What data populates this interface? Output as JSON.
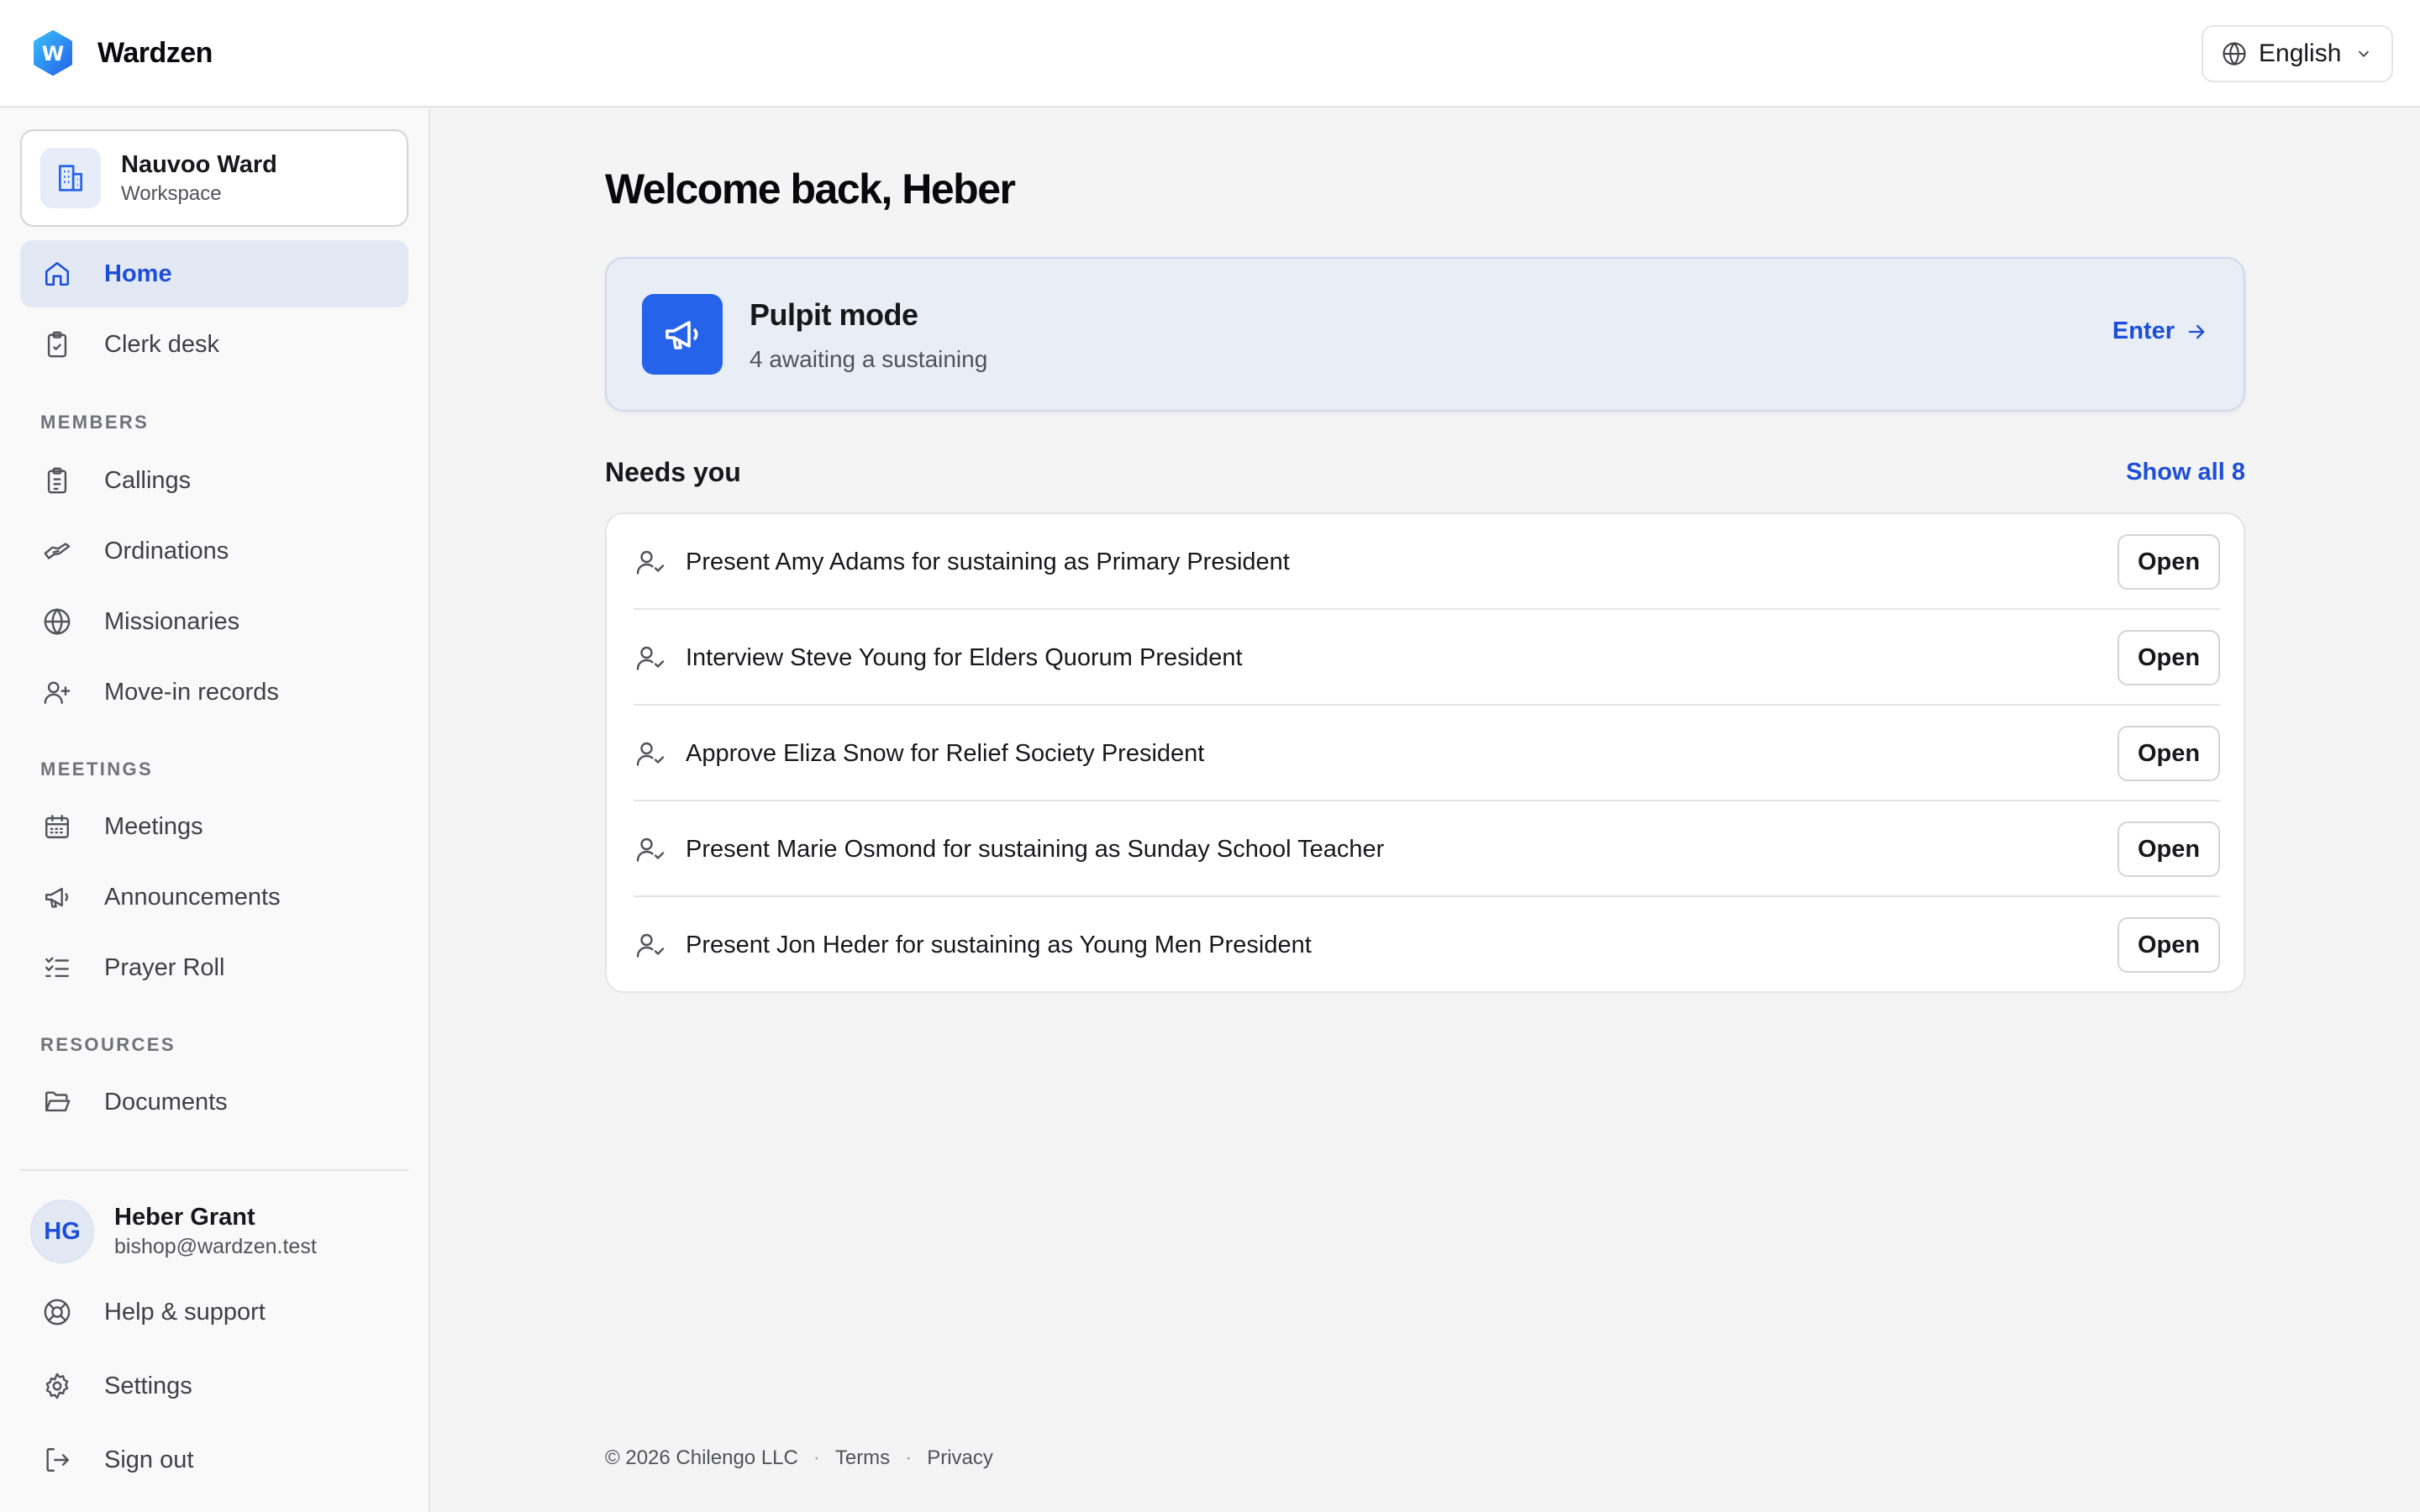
{
  "brand": {
    "name": "Wardzen",
    "logo_letter": "W"
  },
  "language": {
    "label": "English"
  },
  "workspace": {
    "name": "Nauvoo Ward",
    "subtitle": "Workspace"
  },
  "nav": {
    "home": "Home",
    "clerk_desk": "Clerk desk",
    "members_section": "MEMBERS",
    "callings": "Callings",
    "ordinations": "Ordinations",
    "missionaries": "Missionaries",
    "move_in": "Move-in records",
    "meetings_section": "MEETINGS",
    "meetings": "Meetings",
    "announcements": "Announcements",
    "prayer_roll": "Prayer Roll",
    "resources_section": "RESOURCES",
    "documents": "Documents"
  },
  "user": {
    "initials": "HG",
    "name": "Heber Grant",
    "email": "bishop@wardzen.test"
  },
  "bottom_nav": {
    "help": "Help & support",
    "settings": "Settings",
    "sign_out": "Sign out"
  },
  "main": {
    "welcome": "Welcome back, Heber",
    "pulpit": {
      "title": "Pulpit mode",
      "subtitle": "4 awaiting a sustaining",
      "enter": "Enter"
    },
    "needs": {
      "title": "Needs you",
      "show_all": "Show all 8",
      "items": [
        {
          "text": "Present Amy Adams for sustaining as Primary President",
          "action": "Open"
        },
        {
          "text": "Interview Steve Young for Elders Quorum President",
          "action": "Open"
        },
        {
          "text": "Approve Eliza Snow for Relief Society President",
          "action": "Open"
        },
        {
          "text": "Present Marie Osmond for sustaining as Sunday School Teacher",
          "action": "Open"
        },
        {
          "text": "Present Jon Heder for sustaining as Young Men President",
          "action": "Open"
        }
      ]
    }
  },
  "footer": {
    "copyright": "© 2026 Chilengo LLC",
    "sep": "·",
    "terms": "Terms",
    "privacy": "Privacy"
  },
  "colors": {
    "accent": "#2563eb",
    "accent_text": "#1d4ed8",
    "active_bg": "#e3e9f4",
    "pulpit_bg": "#e8edf6"
  }
}
